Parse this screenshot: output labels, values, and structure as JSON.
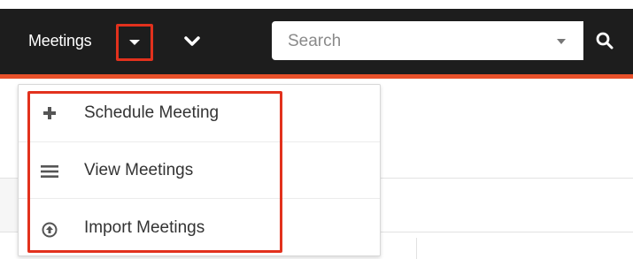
{
  "nav": {
    "module_label": "Meetings",
    "search_placeholder": "Search"
  },
  "dropdown": {
    "items": [
      {
        "label": "Schedule Meeting",
        "icon": "plus-icon"
      },
      {
        "label": "View Meetings",
        "icon": "list-icon"
      },
      {
        "label": "Import Meetings",
        "icon": "upload-circle-icon"
      }
    ]
  },
  "colors": {
    "nav_bg": "#1d1d1d",
    "accent_orange": "#e8502a",
    "highlight_red": "#e2311d"
  }
}
